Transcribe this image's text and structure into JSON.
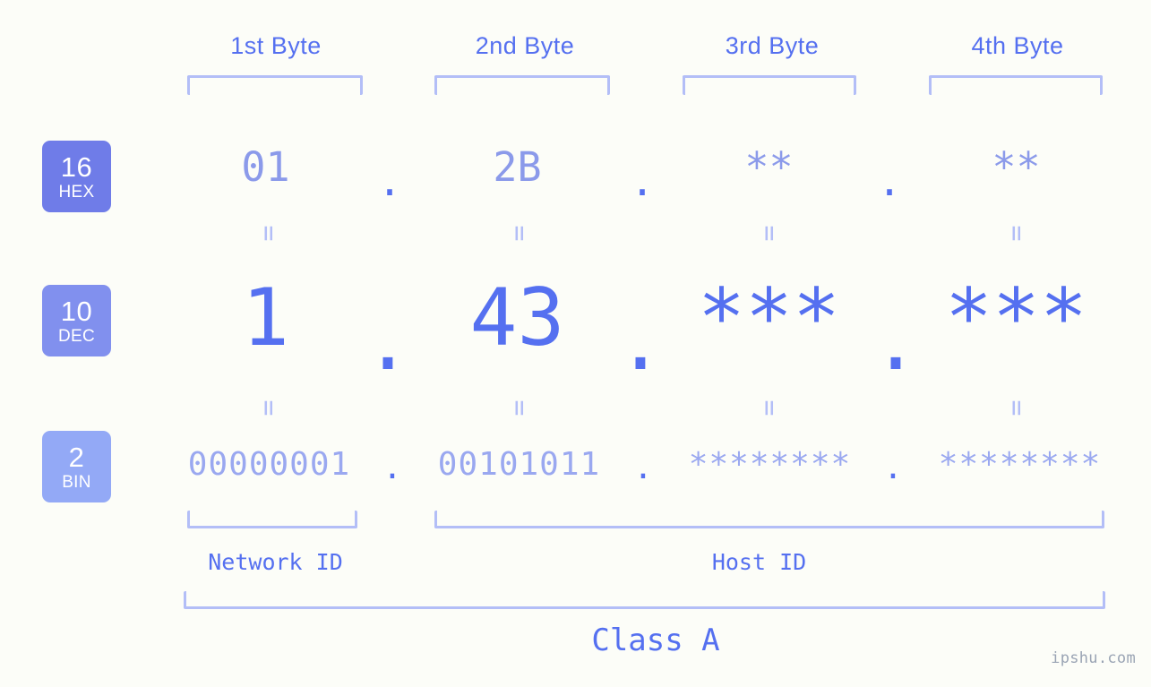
{
  "background_color": "#fcfdf8",
  "accent_color": "#5570f0",
  "muted_accent_color": "#b3bef7",
  "byte_headers": [
    {
      "label": "1st Byte"
    },
    {
      "label": "2nd Byte"
    },
    {
      "label": "3rd Byte"
    },
    {
      "label": "4th Byte"
    }
  ],
  "rows": [
    {
      "badge_number": "16",
      "badge_system": "HEX",
      "badge_color": "#6f7ce8",
      "values": [
        "01",
        "2B",
        "**",
        "**"
      ],
      "separators": [
        ".",
        ".",
        "."
      ]
    },
    {
      "badge_number": "10",
      "badge_system": "DEC",
      "badge_color": "#8190ee",
      "values": [
        "1",
        "43",
        "***",
        "***"
      ],
      "separators": [
        ".",
        ".",
        "."
      ]
    },
    {
      "badge_number": "2",
      "badge_system": "BIN",
      "badge_color": "#93a9f6",
      "values": [
        "00000001",
        "00101011",
        "********",
        "********"
      ],
      "separators": [
        ".",
        ".",
        "."
      ]
    }
  ],
  "equals_separators": [
    "=",
    "=",
    "=",
    "=",
    "=",
    "=",
    "=",
    "="
  ],
  "sections": [
    {
      "label": "Network ID"
    },
    {
      "label": "Host ID"
    }
  ],
  "class_label": "Class A",
  "watermark": "ipshu.com"
}
